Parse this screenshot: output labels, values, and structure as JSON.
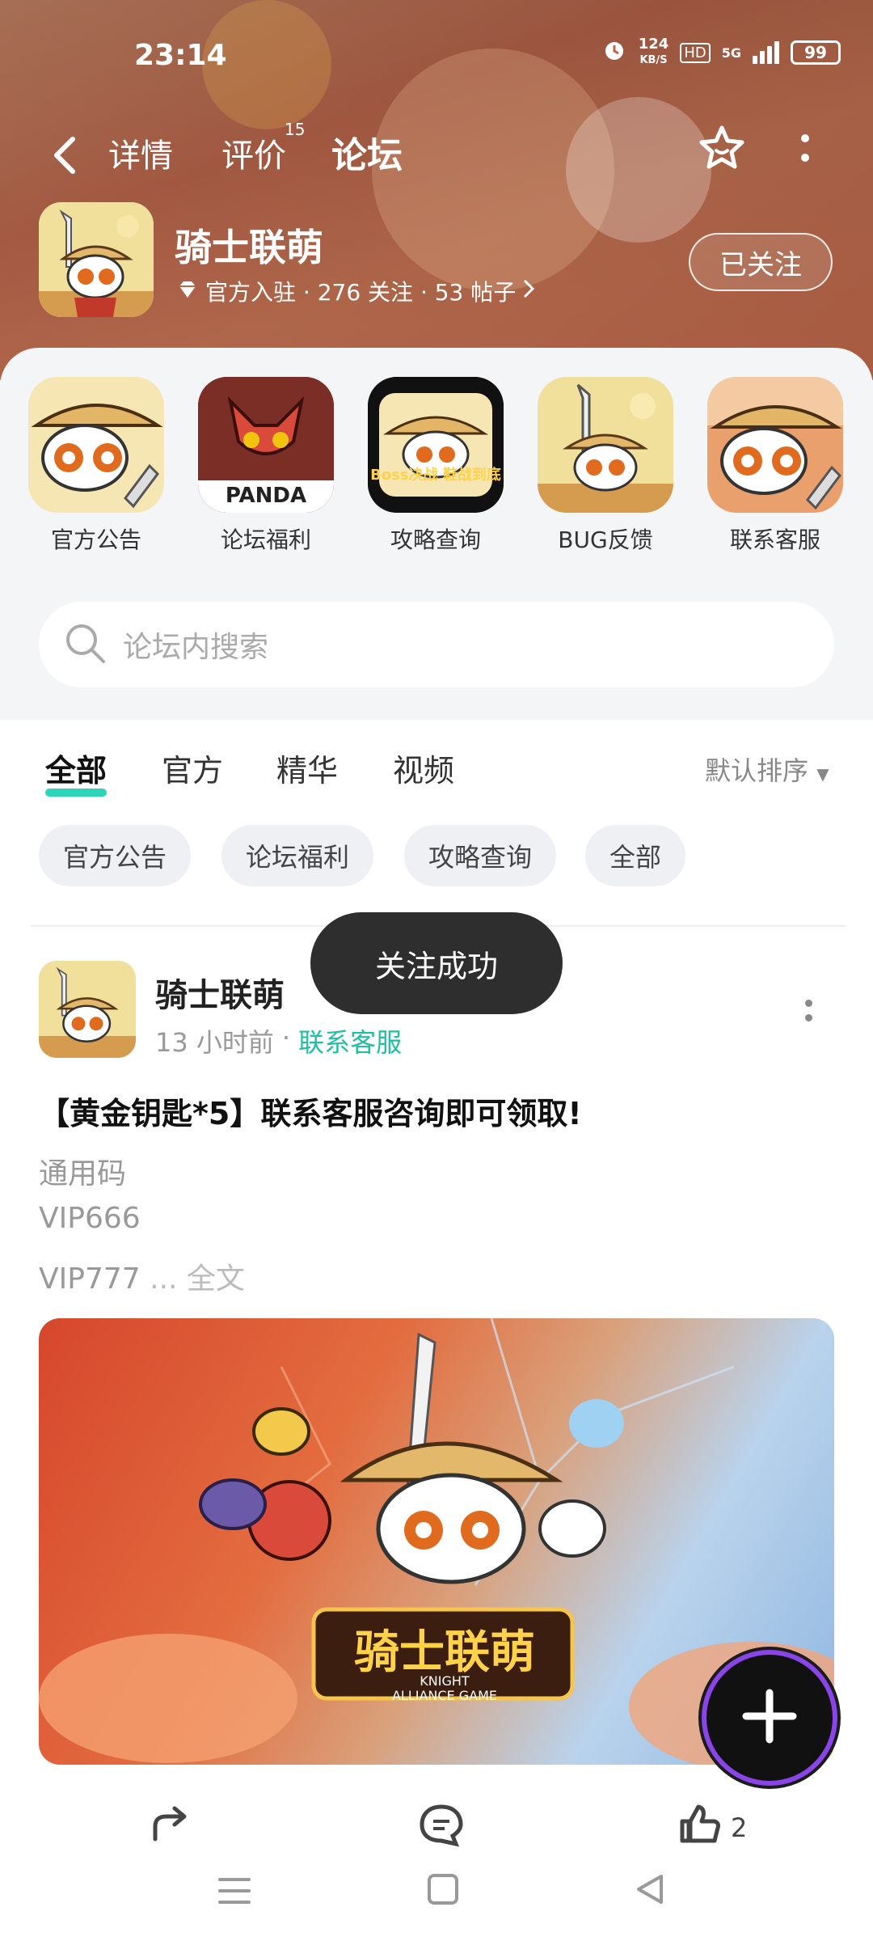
{
  "status_bar": {
    "time": "23:14",
    "net_speed_top": "124",
    "net_speed_bottom": "KB/S",
    "hd": "HD",
    "network": "5G",
    "battery": "99"
  },
  "nav": {
    "tabs": [
      {
        "label": "详情"
      },
      {
        "label": "评价"
      },
      {
        "label": "论坛"
      }
    ],
    "review_count": "15",
    "active_tab": "论坛"
  },
  "app": {
    "name": "骑士联萌",
    "meta": "官方入驻 · 276 关注 · 53 帖子",
    "follow_label": "已关注"
  },
  "shortcuts": [
    {
      "label": "官方公告"
    },
    {
      "label": "论坛福利",
      "icon_text": "PANDA"
    },
    {
      "label": "攻略查询",
      "icon_text": "Boss决战 鞋战到底"
    },
    {
      "label": "BUG反馈"
    },
    {
      "label": "联系客服"
    }
  ],
  "search": {
    "placeholder": "论坛内搜索"
  },
  "filter_tabs": [
    "全部",
    "官方",
    "精华",
    "视频"
  ],
  "sort_label": "默认排序",
  "chips": [
    "官方公告",
    "论坛福利",
    "攻略查询",
    "全部"
  ],
  "toast": "关注成功",
  "post": {
    "author": "骑士联萌",
    "time": "13 小时前",
    "tag": "联系客服",
    "title": "【黄金钥匙*5】联系客服咨询即可领取!",
    "lines": [
      "通用码",
      "VIP666",
      "VIP777"
    ],
    "more": "... 全文",
    "image_logo": "骑士联萌",
    "image_sub1": "KNIGHT",
    "image_sub2": "ALLIANCE GAME",
    "like_count": "2"
  },
  "colors": {
    "accent": "#2ed4b8",
    "tag": "#1fbfa3",
    "toast_bg": "#2e2e2e"
  }
}
